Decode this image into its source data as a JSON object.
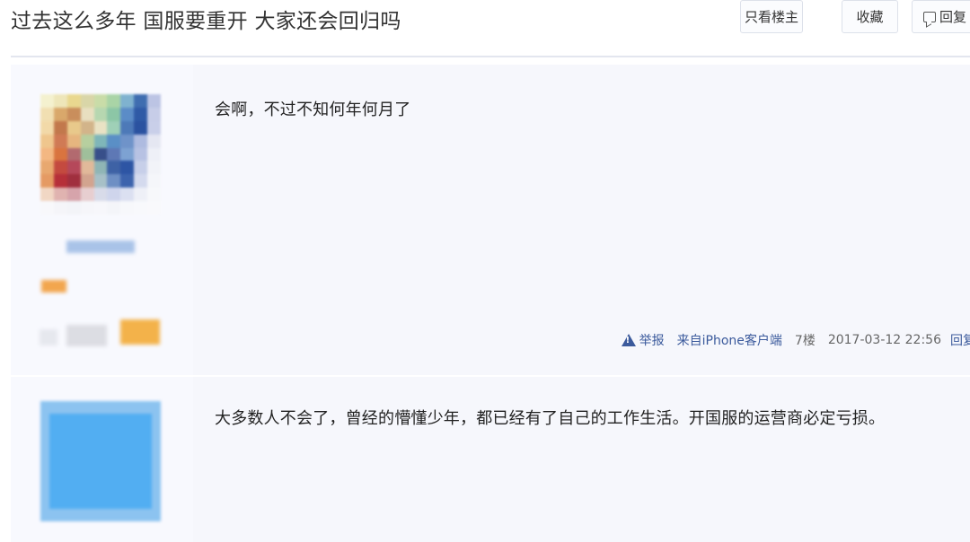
{
  "thread": {
    "title": "过去这么多年 国服要重开 大家还会回归吗"
  },
  "toolbar": {
    "only_op_label": "只看楼主",
    "favorite_label": "收藏",
    "reply_label": "回复"
  },
  "posts": [
    {
      "content": "会啊，不过不知何年何月了",
      "report_label": "举报",
      "client": "来自iPhone客户端",
      "floor": "7楼",
      "time": "2017-03-12 22:56",
      "reply_label": "回复"
    },
    {
      "content": "大多数人不会了，曾经的懵懂少年，都已经有了自己的工作生活。开国服的运营商必定亏损。"
    }
  ],
  "colors": {
    "link": "#3b5a9c",
    "post_bg": "#f8f9fe",
    "divider": "#e3e6ef"
  },
  "icons": {
    "report": "warning-triangle-icon",
    "reply": "speech-bubble-icon"
  }
}
